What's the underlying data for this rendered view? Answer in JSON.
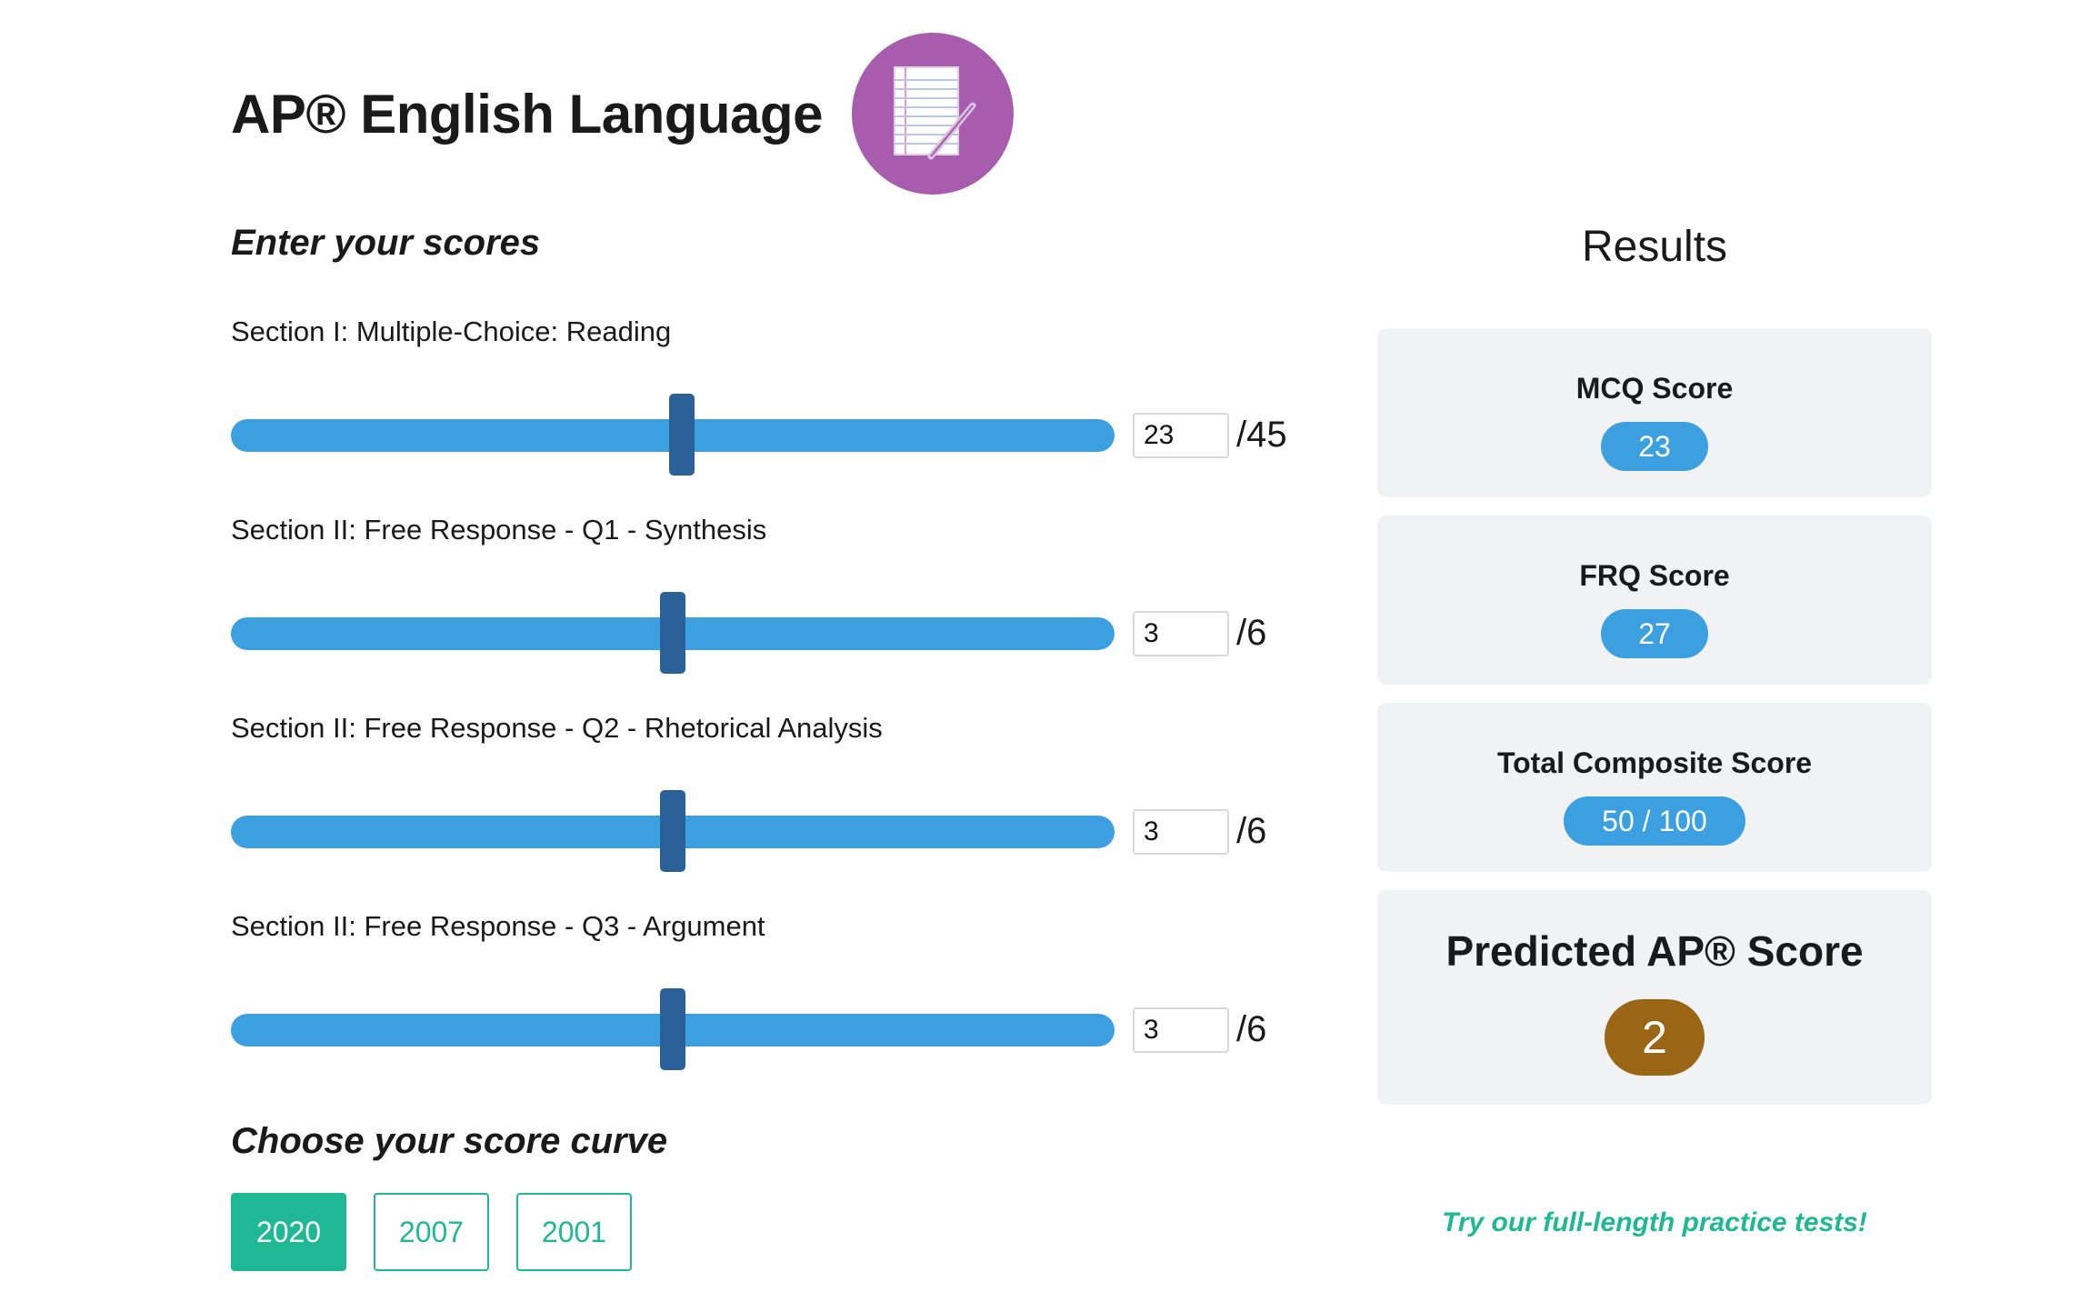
{
  "header": {
    "title": "AP® English Language",
    "icon": "notebook-pencil-icon"
  },
  "colors": {
    "accent_blue": "#3b9fe0",
    "thumb_blue": "#2b6199",
    "green": "#1fb894",
    "purple": "#a75cae",
    "predicted": "#9b6516",
    "card_bg": "#f0f2f4"
  },
  "inputs": {
    "heading": "Enter your scores",
    "sections": [
      {
        "label": "Section I: Multiple-Choice: Reading",
        "value": "23",
        "max": "/45",
        "level": 0.5
      },
      {
        "label": "Section II: Free Response - Q1 - Synthesis",
        "value": "3",
        "max": "/6",
        "level": 0.5
      },
      {
        "label": "Section II: Free Response - Q2 - Rhetorical Analysis",
        "value": "3",
        "max": "/6",
        "level": 0.5
      },
      {
        "label": "Section II: Free Response - Q3 - Argument",
        "value": "3",
        "max": "/6",
        "level": 0.5
      }
    ]
  },
  "curve": {
    "heading": "Choose your score curve",
    "options": [
      "2020",
      "2007",
      "2001"
    ],
    "selected": "2020"
  },
  "results": {
    "heading": "Results",
    "mcq": {
      "title": "MCQ Score",
      "value": "23"
    },
    "frq": {
      "title": "FRQ Score",
      "value": "27"
    },
    "composite": {
      "title": "Total Composite Score",
      "value": "50 / 100"
    },
    "predicted": {
      "title": "Predicted AP® Score",
      "value": "2"
    }
  },
  "practice_link": "Try our full-length practice tests!"
}
